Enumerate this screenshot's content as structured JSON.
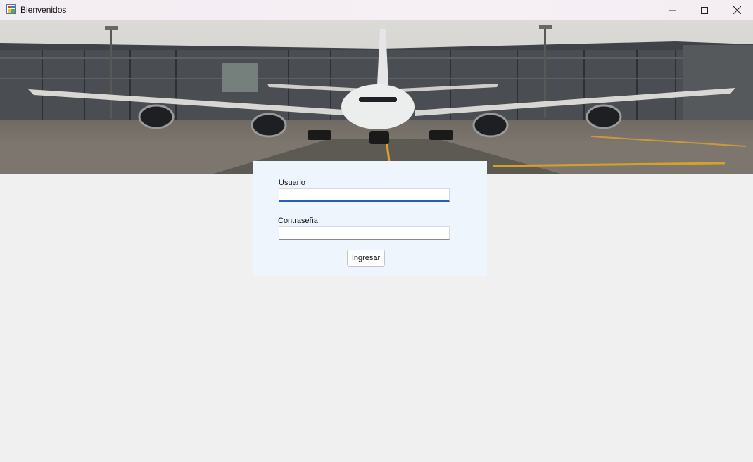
{
  "window": {
    "title": "Bienvenidos",
    "app_icon": "windows-form-icon",
    "controls": [
      "minimize-icon",
      "maximize-icon",
      "close-icon"
    ]
  },
  "hero": {
    "image": "airplane-at-airport-terminal"
  },
  "login": {
    "user_label": "Usuario",
    "user_value": "",
    "password_label": "Contraseña",
    "password_value": "",
    "submit_label": "Ingresar"
  },
  "colors": {
    "panel_bg": "#eef5fd",
    "focus_accent": "#1f62b3",
    "window_bg": "#f0f0f0"
  }
}
